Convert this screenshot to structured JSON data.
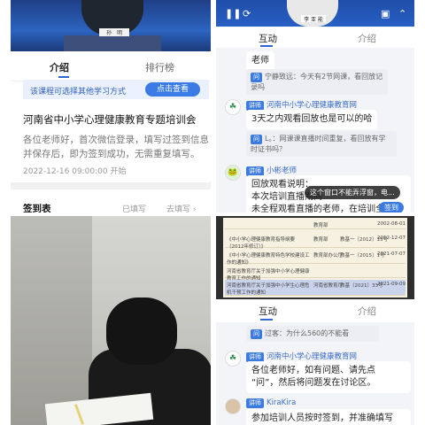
{
  "p1": {
    "presenter_card": "孙　明",
    "tabs": [
      "介绍",
      "排行榜"
    ],
    "notice": "该课程可选择其他学习方式",
    "notice_button": "点击查看",
    "course_title": "河南省中小学心理健康教育专题培训会",
    "course_desc": "各位老师好，首次微信登录，填写过签到信息并保存后，即为签到成功，无需重复填写。",
    "course_time": "2022-12-16 09:00:00 开始",
    "signin_label": "签到表",
    "sign_right_1": "已填写",
    "sign_right_2": "去填写 ›"
  },
  "p2": {
    "presenter_card": "李 亚 能",
    "tabs": [
      "互动",
      "介绍"
    ],
    "msg_top": "老师",
    "quote1_user": "宁静致远",
    "quote1_text": "今天有2节网课，看回放记录吗",
    "sender1": "河南中小学心理健康教育网",
    "reply1": "3天之内观看回放也是可以的哈",
    "quote2_user": "L。",
    "quote2_text": "网课课直播时间重复，看回放有学时证书吗？",
    "sender2": "小彬老师",
    "reply2_l1": "回放观看说明：",
    "reply2_l2": "本次培训直播期间",
    "reply2_l3": "未全程观看直播的老师，在培训全部",
    "tip1": "这个窗口不能弄浮窗，电...",
    "tip2": "签到",
    "badge": "讲师"
  },
  "p4": {
    "doc_rows": [
      [
        "",
        "教育部",
        "",
        "2002-08-01"
      ],
      [
        "《中小学心理健康教育指导纲要（2012年修订）》",
        "教育部",
        "教基一〔2012〕15号",
        "2012-12-07"
      ],
      [
        "《中小学心理健康教育特色学校建设工作的通知》",
        "教育部办公厅",
        "教基一〔2015〕1号",
        "2021-07-07"
      ],
      [
        "河南省教育厅关于加强中小学心理健康教育工作的通知",
        "",
        "",
        ""
      ],
      [
        "河南省教育厅关于加强中小学生心理危机干预工作的通知",
        "河南省教育厅",
        "教基〔2021〕33号",
        "2021-09-09"
      ]
    ],
    "tabs": [
      "互动",
      "介绍"
    ],
    "quote_user": "过客",
    "quote_text": "为什么560的不能看",
    "sender1": "河南中小学心理健康教育网",
    "reply1_l1": "各位老师好，如有问题、请先点",
    "reply1_l2": "“问”，然后将问题发在讨论区。",
    "sender2": "KiraKira",
    "reply2_l1": "参加培训人员按时签到，并准确填写",
    "badge": "讲师"
  },
  "colors": {
    "accent": "#2f66d0",
    "badge": "#3b7be0"
  }
}
